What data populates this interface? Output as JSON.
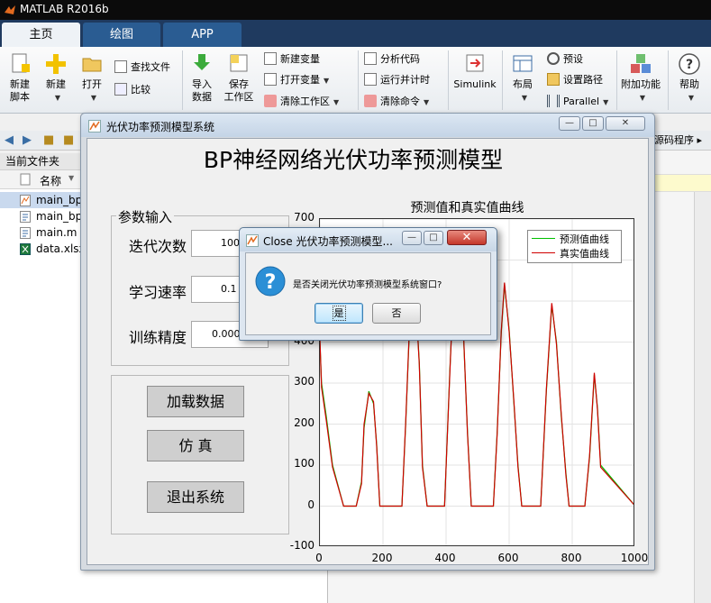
{
  "app": {
    "title": "MATLAB R2016b"
  },
  "tabs": [
    {
      "label": "主页"
    },
    {
      "label": "绘图"
    },
    {
      "label": "APP"
    }
  ],
  "ribbon": {
    "new_script": "新建\n脚本",
    "new": "新建",
    "open": "打开",
    "find_files": "查找文件",
    "compare": "比较",
    "import_data": "导入\n数据",
    "save_workspace": "保存\n工作区",
    "new_variable": "新建变量",
    "open_variable": "打开变量",
    "clear_workspace": "清除工作区",
    "analyze_code": "分析代码",
    "run_and_time": "运行并计时",
    "clear_commands": "清除命令",
    "simulink": "Simulink",
    "layout": "布局",
    "preferences": "预设",
    "set_path": "设置路径",
    "parallel": "Parallel",
    "addons": "附加功能",
    "help": "帮助"
  },
  "file_panel": {
    "title": "当前文件夹",
    "column_name": "名称",
    "files": [
      {
        "name": "main_bp",
        "icon": "fig-file-icon"
      },
      {
        "name": "main_bp",
        "icon": "m-file-icon"
      },
      {
        "name": "main.m",
        "icon": "m-file-icon"
      },
      {
        "name": "data.xlsx",
        "icon": "excel-file-icon"
      }
    ],
    "editor_tab": "源码程序"
  },
  "gui": {
    "window_title": "光伏功率预测模型系统",
    "heading": "BP神经网络光伏功率预测模型",
    "param_group": "参数输入",
    "params": [
      {
        "label": "迭代次数",
        "value": "100"
      },
      {
        "label": "学习速率",
        "value": "0.1"
      },
      {
        "label": "训练精度",
        "value": "0.0000"
      }
    ],
    "buttons": {
      "load": "加载数据",
      "simulate": "仿 真",
      "exit": "退出系统"
    }
  },
  "chart_data": {
    "type": "line",
    "title": "预测值和真实值曲线",
    "xlim": [
      0,
      1000
    ],
    "ylim": [
      -100,
      700
    ],
    "xticks": [
      0,
      200,
      400,
      600,
      800,
      1000
    ],
    "yticks": [
      -100,
      0,
      100,
      200,
      300,
      400,
      500,
      600,
      700
    ],
    "grid": true,
    "legend_placement": "top-right",
    "series": [
      {
        "name": "预测值曲线",
        "color": "#00c000",
        "x": [
          0,
          5,
          20,
          40,
          75,
          115,
          132,
          140,
          155,
          170,
          180,
          190,
          260,
          272,
          285,
          300,
          315,
          325,
          340,
          395,
          412,
          425,
          440,
          455,
          468,
          480,
          550,
          562,
          575,
          585,
          600,
          615,
          628,
          640,
          660,
          700,
          718,
          735,
          750,
          765,
          780,
          790,
          840,
          855,
          870,
          880,
          890,
          1000
        ],
        "y": [
          400,
          300,
          220,
          100,
          0,
          0,
          60,
          190,
          280,
          250,
          150,
          0,
          0,
          200,
          450,
          560,
          350,
          100,
          0,
          0,
          330,
          560,
          590,
          420,
          180,
          0,
          0,
          180,
          420,
          540,
          430,
          250,
          100,
          0,
          0,
          0,
          280,
          490,
          400,
          220,
          80,
          0,
          0,
          120,
          320,
          240,
          100,
          0
        ]
      },
      {
        "name": "真实值曲线",
        "color": "#d00000",
        "x": [
          0,
          5,
          20,
          40,
          75,
          115,
          132,
          140,
          155,
          170,
          180,
          190,
          260,
          272,
          285,
          300,
          315,
          325,
          340,
          395,
          412,
          425,
          440,
          455,
          468,
          480,
          550,
          562,
          575,
          585,
          600,
          615,
          628,
          640,
          660,
          700,
          718,
          735,
          750,
          765,
          780,
          790,
          840,
          855,
          870,
          880,
          890,
          1000
        ],
        "y": [
          410,
          290,
          210,
          95,
          0,
          0,
          55,
          200,
          275,
          255,
          145,
          0,
          0,
          205,
          455,
          555,
          345,
          95,
          0,
          0,
          325,
          565,
          585,
          425,
          175,
          0,
          0,
          175,
          425,
          545,
          425,
          255,
          95,
          0,
          0,
          0,
          285,
          495,
          395,
          225,
          75,
          0,
          0,
          125,
          325,
          235,
          95,
          0
        ]
      }
    ]
  },
  "dialog": {
    "title": "Close 光伏功率预测模型...",
    "message": "是否关闭光伏功率预测模型系统窗口?",
    "yes": "是",
    "no": "否"
  },
  "colors": {
    "accent": "#2a5c92",
    "tab_active": "#eef2f6"
  }
}
